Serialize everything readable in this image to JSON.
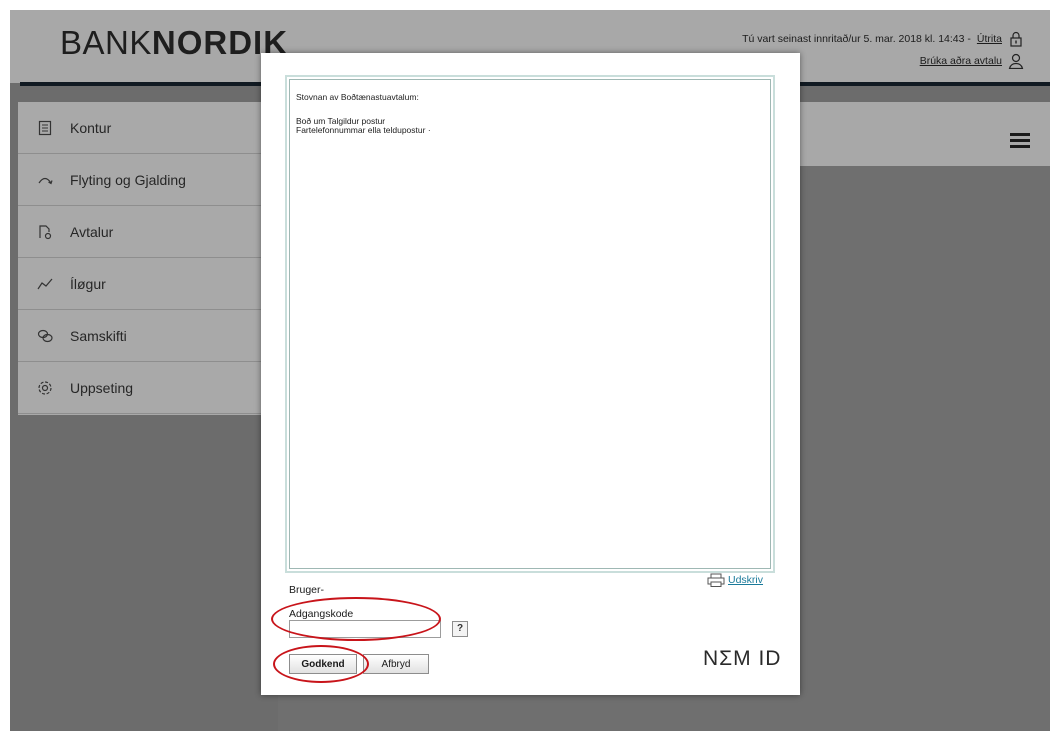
{
  "header": {
    "logo_left": "BANK",
    "logo_right": "NORDIK",
    "last_login": "Tú vart seinast innritað/ur 5. mar. 2018 kl. 14:43 -",
    "logout_label": "Útrita",
    "switch_agreement_label": "Brúka aðra avtalu"
  },
  "sidebar": {
    "items": [
      {
        "label": "Kontur",
        "icon": "document-icon"
      },
      {
        "label": "Flyting og Gjalding",
        "icon": "arrow-curve-icon"
      },
      {
        "label": "Avtalur",
        "icon": "agreement-icon"
      },
      {
        "label": "Íløgur",
        "icon": "chart-line-icon"
      },
      {
        "label": "Samskifti",
        "icon": "chat-icon"
      },
      {
        "label": "Uppseting",
        "icon": "gear-icon"
      }
    ]
  },
  "modal": {
    "document_title": "Stovnan av Boðtænastuavtalum:",
    "document_line1": "Boð um Talgildur postur",
    "document_line2": "Fartelefonnummar ella teldupostur ·",
    "print_label": "Udskriv",
    "user_label": "Bruger-",
    "password_label": "Adgangskode",
    "password_value": "",
    "help_label": "?",
    "approve_label": "Godkend",
    "cancel_label": "Afbryd",
    "brand": "NΣM ID"
  },
  "colors": {
    "overlay": "#6c6c6c",
    "accent_link": "#1a7a9a",
    "highlight": "#c8141a",
    "doc_border": "#c9dedb"
  }
}
